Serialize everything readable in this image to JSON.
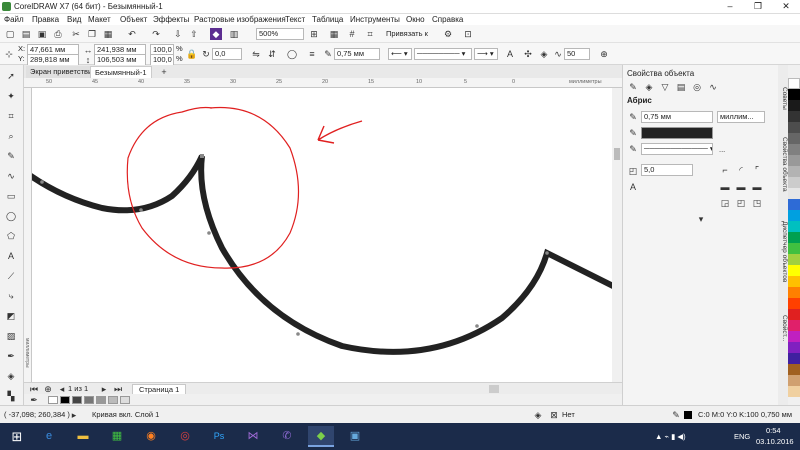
{
  "window": {
    "title": "CorelDRAW X7 (64 бит) - Безымянный-1",
    "min_label": "–",
    "max_label": "❐",
    "close_label": "✕"
  },
  "menu": [
    "Файл",
    "Правка",
    "Вид",
    "Макет",
    "Объект",
    "Эффекты",
    "Растровые изображения",
    "Текст",
    "Таблица",
    "Инструменты",
    "Окно",
    "Справка"
  ],
  "toolbar1": {
    "zoom_value": "500%",
    "snap_label": "Привязать к"
  },
  "toolbar2": {
    "x_label": "X:",
    "x_value": "47,661 мм",
    "y_label": "Y:",
    "y_value": "289,818 мм",
    "w_value": "241,938 мм",
    "h_value": "106,503 мм",
    "scale_x": "100,0",
    "scale_y": "100,0",
    "percent": "%",
    "rotation": "0,0",
    "outline_width": "0,75 мм",
    "smoothing": "50"
  },
  "document_tabs": [
    "Экран приветствия",
    "Безымянный-1"
  ],
  "ruler": {
    "h_ticks": [
      "50",
      "45",
      "40",
      "35",
      "30",
      "25",
      "20",
      "15",
      "10",
      "5",
      "0"
    ],
    "h_unit": "миллиметры",
    "v_unit": "миллиметры"
  },
  "pagebar": {
    "page_count": "1 из 1",
    "page_tab": "Страница 1"
  },
  "docker": {
    "title": "Свойства объекта",
    "section": "Абрис",
    "width_value": "0,75 мм",
    "units_value": "миллим...",
    "dots": "...",
    "miter_value": "5,0"
  },
  "docker_tabs": [
    "Советы",
    "Свойства объекта",
    "Диспетчер объектов",
    "Свойст..."
  ],
  "statusbar": {
    "coords": "( -37,098; 260,384 )",
    "object_info": "Кривая вкл. Слой 1",
    "fill_label": "Нет",
    "outline_info": "C:0 M:0 Y:0 K:100  0,750 мм"
  },
  "taskbar": {
    "lang": "ENG",
    "time": "0:54",
    "date": "03.10.2016"
  },
  "colors": {
    "taskbar": "#1b2b4a",
    "curve": "#222222",
    "annotation": "#e02020"
  }
}
